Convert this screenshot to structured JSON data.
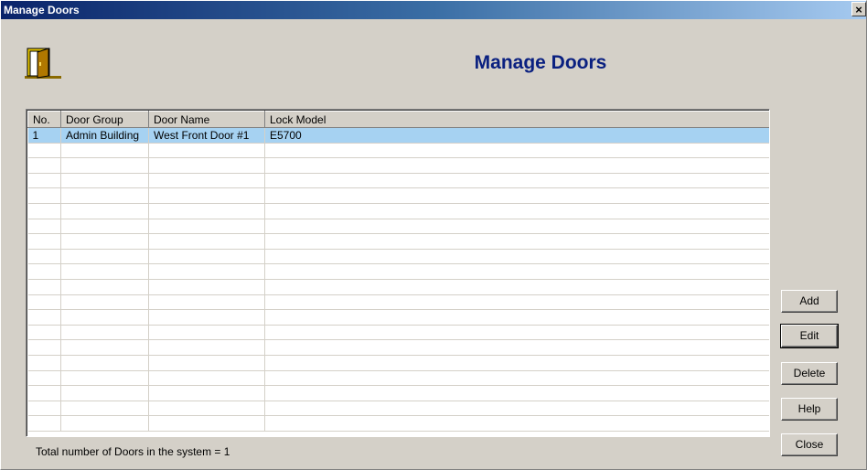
{
  "window": {
    "title": "Manage Doors",
    "close_glyph": "×"
  },
  "header": {
    "heading": "Manage Doors",
    "icon": "door-icon"
  },
  "table": {
    "columns": [
      "No.",
      "Door Group",
      "Door Name",
      "Lock Model"
    ],
    "rows": [
      [
        "1",
        "Admin Building",
        "West Front Door #1",
        "E5700"
      ]
    ],
    "selected_row": 0
  },
  "buttons": {
    "add": "Add",
    "edit": "Edit",
    "delete": "Delete",
    "help": "Help",
    "close": "Close"
  },
  "status": {
    "text": "Total number of Doors in the system =  1"
  },
  "colors": {
    "window_bg": "#d4d0c8",
    "heading": "#0a2080",
    "selection": "#a6d2f2",
    "titlebar_start": "#0a246a",
    "titlebar_end": "#a6caf0"
  }
}
